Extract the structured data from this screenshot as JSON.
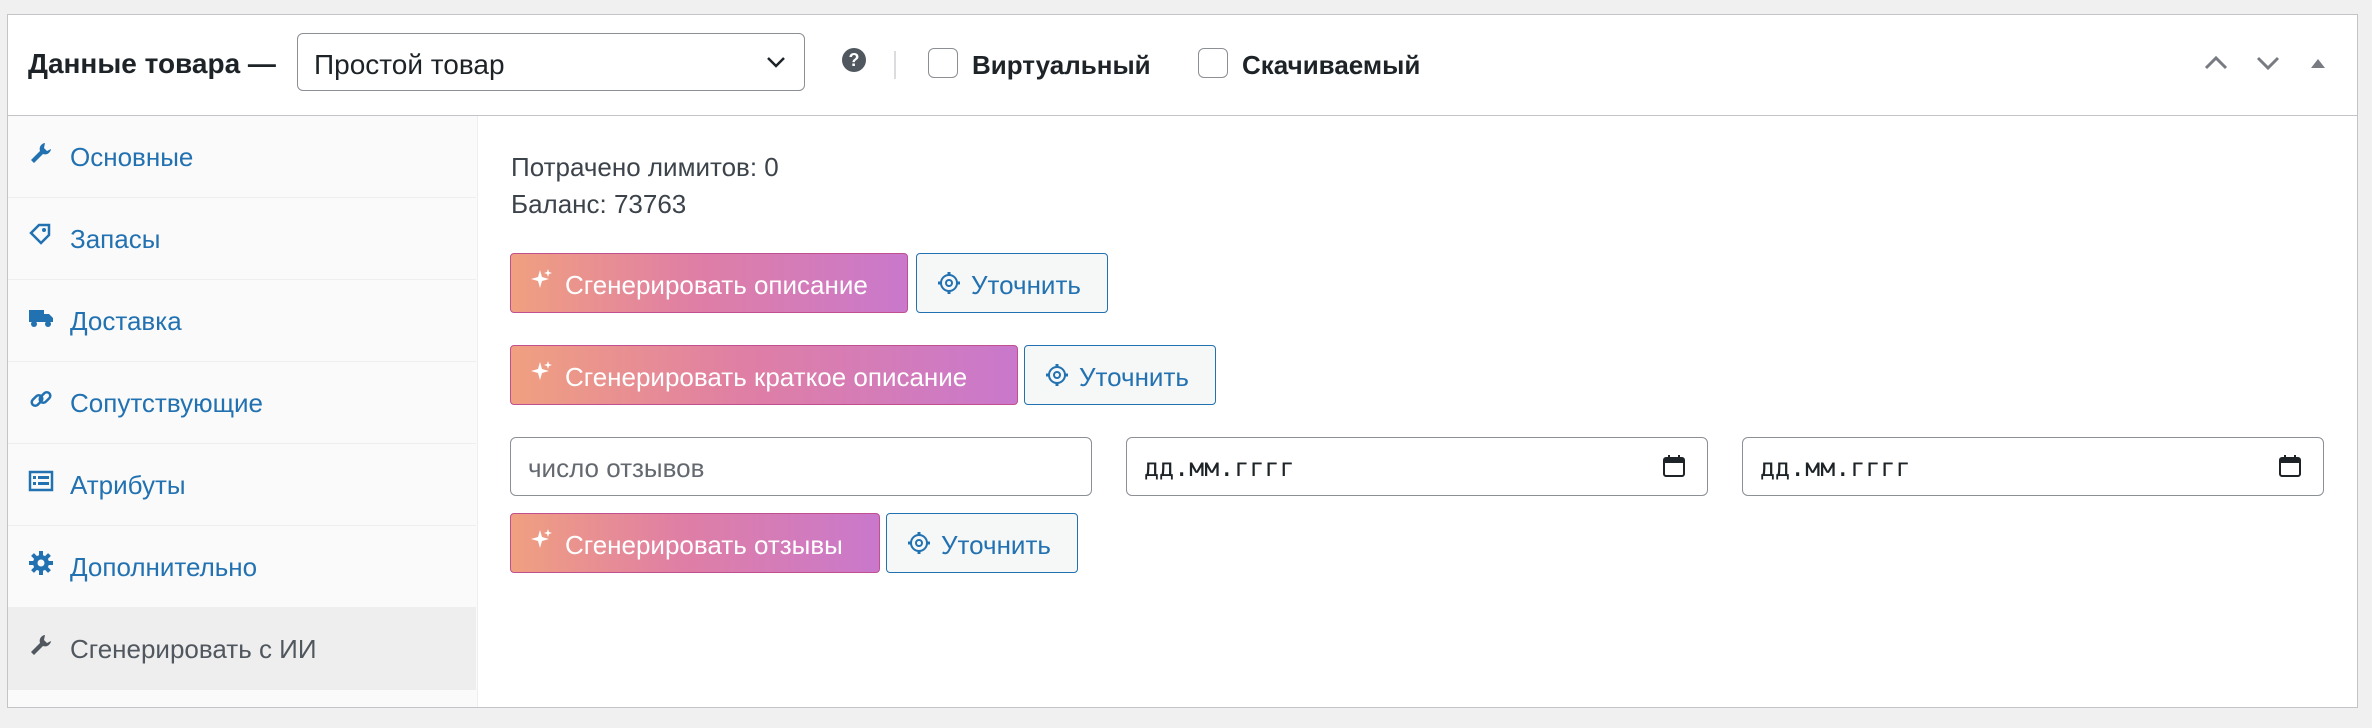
{
  "header": {
    "title": "Данные товара —",
    "product_type": "Простой товар",
    "help_symbol": "?",
    "virtual_label": "Виртуальный",
    "downloadable_label": "Скачиваемый"
  },
  "sidebar": {
    "items": [
      {
        "label": "Основные",
        "icon": "wrench-icon"
      },
      {
        "label": "Запасы",
        "icon": "tag-icon"
      },
      {
        "label": "Доставка",
        "icon": "truck-icon"
      },
      {
        "label": "Сопутствующие",
        "icon": "link-icon"
      },
      {
        "label": "Атрибуты",
        "icon": "list-view-icon"
      },
      {
        "label": "Дополнительно",
        "icon": "gear-icon"
      },
      {
        "label": "Сгенерировать с ИИ",
        "icon": "wrench-icon"
      }
    ],
    "active_index": 6
  },
  "main": {
    "limits_used": "Потрачено лимитов: 0",
    "balance": "Баланс: 73763",
    "generate_description": "Сгенерировать описание",
    "generate_short_description": "Сгенерировать краткое описание",
    "generate_reviews": "Сгенерировать отзывы",
    "refine_label": "Уточнить",
    "reviews_count_placeholder": "число отзывов",
    "date_placeholder": "дд.мм.гггг"
  },
  "colors": {
    "link": "#2271b1",
    "gradient_start": "#f0a080",
    "gradient_end": "#c978cc",
    "border": "#c3c4c7"
  }
}
